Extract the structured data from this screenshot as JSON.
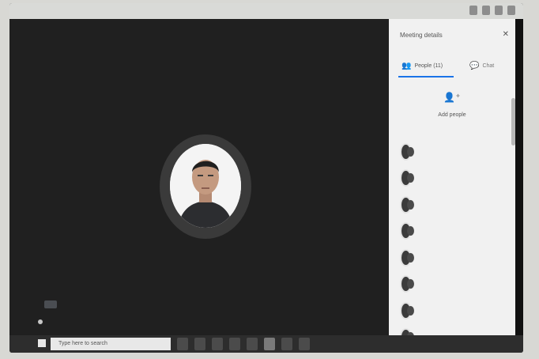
{
  "browser": {
    "title": "",
    "url": ""
  },
  "meeting": {
    "caption": "",
    "self_name": ""
  },
  "panel": {
    "title": "Meeting details",
    "tabs": [
      {
        "label": "People (11)",
        "icon": "people-icon"
      },
      {
        "label": "Chat",
        "icon": "chat-icon"
      }
    ],
    "add_people_label": "Add people",
    "participants": [
      {
        "name": ""
      },
      {
        "name": ""
      },
      {
        "name": ""
      },
      {
        "name": ""
      },
      {
        "name": ""
      },
      {
        "name": ""
      },
      {
        "name": ""
      },
      {
        "name": ""
      }
    ]
  },
  "taskbar": {
    "search_placeholder": "Type here to search",
    "tray_text": "",
    "time": "",
    "date": ""
  },
  "colors": {
    "accent": "#1a73e8",
    "stage": "#202020",
    "panel": "#f1f1f1"
  }
}
